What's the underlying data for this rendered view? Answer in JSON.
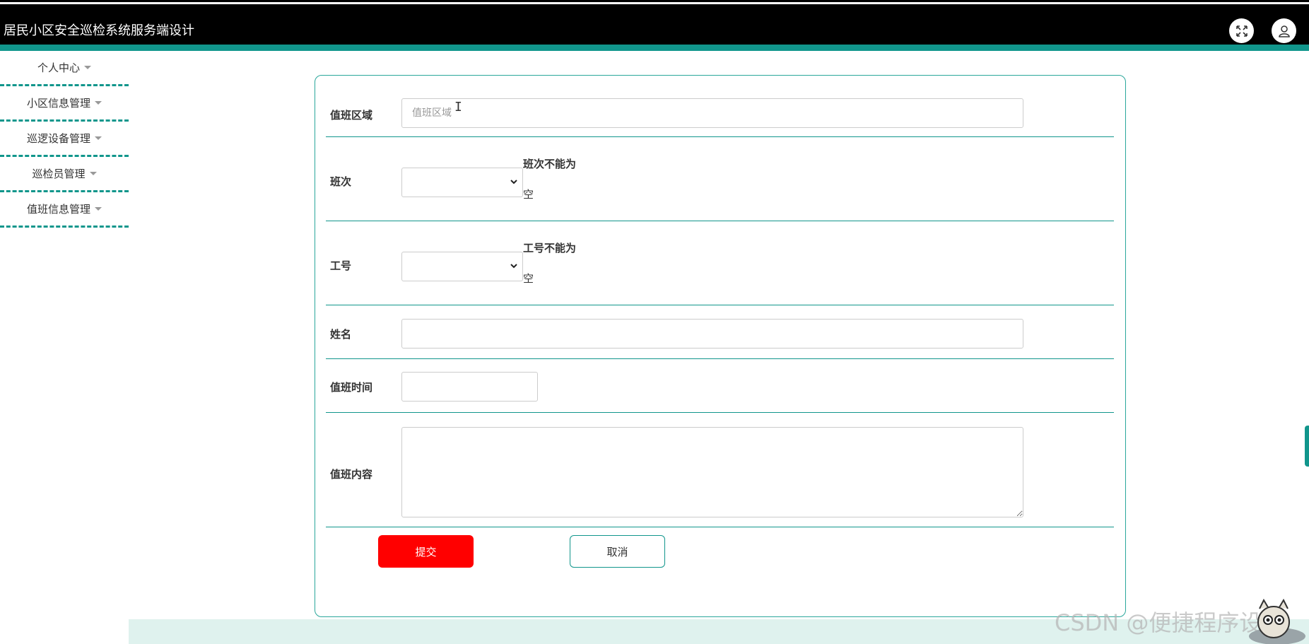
{
  "header": {
    "title": "居民小区安全巡检系统服务端设计",
    "fullscreen_icon": "expand-icon",
    "user_icon": "user-icon"
  },
  "sidebar": {
    "items": [
      {
        "label": "个人中心"
      },
      {
        "label": "小区信息管理"
      },
      {
        "label": "巡逻设备管理"
      },
      {
        "label": "巡检员管理"
      },
      {
        "label": "值班信息管理"
      }
    ]
  },
  "form": {
    "area": {
      "label": "值班区域",
      "placeholder": "值班区域",
      "value": ""
    },
    "shift": {
      "label": "班次",
      "value": "",
      "error_line1": "班次不能为",
      "error_line2": "空"
    },
    "job_no": {
      "label": "工号",
      "value": "",
      "error_line1": "工号不能为",
      "error_line2": "空"
    },
    "name": {
      "label": "姓名",
      "value": ""
    },
    "duty_time": {
      "label": "值班时间",
      "value": ""
    },
    "duty_content": {
      "label": "值班内容",
      "value": ""
    },
    "submit_label": "提交",
    "cancel_label": "取消"
  },
  "watermark": "CSDN @便捷程序设计",
  "colors": {
    "accent": "#11968c",
    "header_bg": "#000000",
    "submit": "#ff0000"
  }
}
